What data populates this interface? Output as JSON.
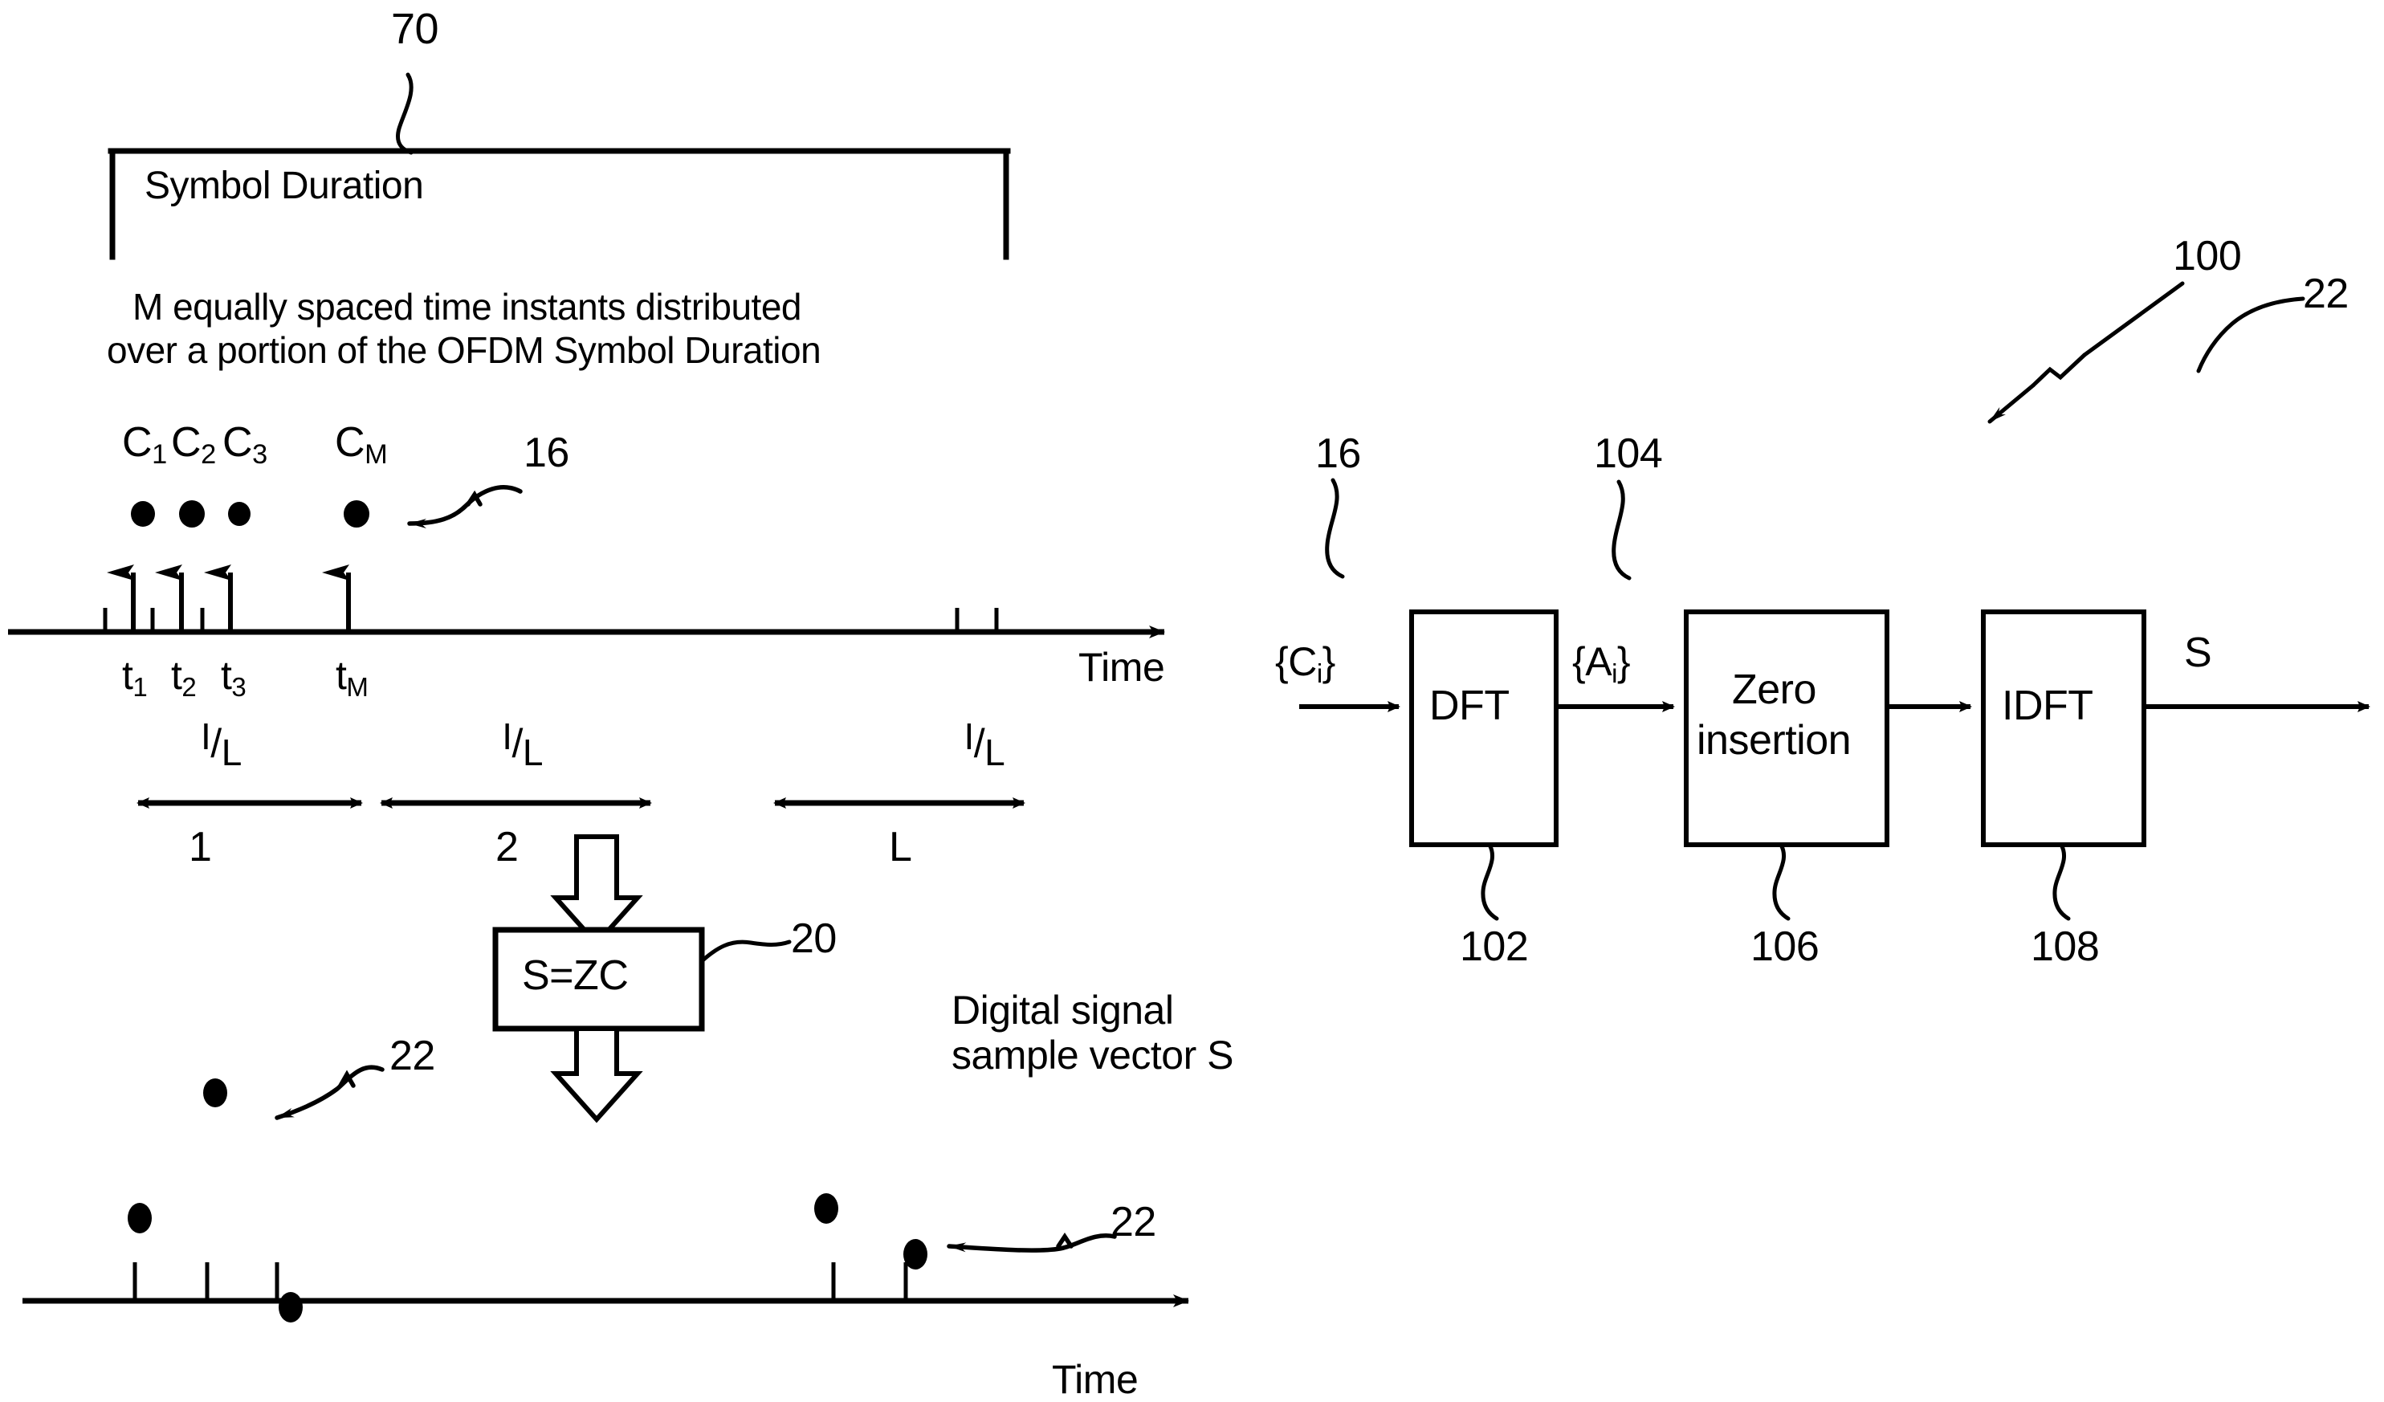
{
  "figure": {
    "title_ref": "70",
    "symbol_duration_label": "Symbol Duration",
    "description_line1": "M equally spaced time instants distributed",
    "description_line2": "over a portion of the OFDM Symbol Duration"
  },
  "coefficients": {
    "c1": "C",
    "c1_sub": "1",
    "c2": "C",
    "c2_sub": "2",
    "c3": "C",
    "c3_sub": "3",
    "cm": "C",
    "cm_sub": "M",
    "ref_16": "16"
  },
  "time_ticks": {
    "t1": "t",
    "t1_sub": "1",
    "t2": "t",
    "t2_sub": "2",
    "t3": "t",
    "t3_sub": "3",
    "tm": "t",
    "tm_sub": "M"
  },
  "axes": {
    "time_label_top": "Time",
    "time_label_bottom": "Time"
  },
  "intervals": {
    "fraction_num": "I",
    "fraction_slash": "/",
    "fraction_den": "L",
    "segment_1": "1",
    "segment_2": "2",
    "segment_L": "L"
  },
  "zc_block": {
    "label": "S=ZC",
    "ref": "20"
  },
  "digital_signal": {
    "caption_line1": "Digital signal",
    "caption_line2": "sample vector S",
    "ref_a": "22",
    "ref_b": "22"
  },
  "block_diagram": {
    "ref_100": "100",
    "input_ref": "16",
    "input_set": "{C",
    "input_set_sub": "i",
    "input_set_close": "}",
    "mid_ref": "104",
    "mid_set": "{A",
    "mid_set_sub": "i",
    "mid_set_close": "}",
    "output_label": "S",
    "output_ref": "22",
    "blocks": [
      {
        "name": "DFT",
        "ref": "102"
      },
      {
        "name": "Zero\ninsertion",
        "ref": "106"
      },
      {
        "name": "IDFT",
        "ref": "108"
      }
    ],
    "block1_label": "DFT",
    "block1_ref": "102",
    "block2_label_line1": "Zero",
    "block2_label_line2": "insertion",
    "block2_ref": "106",
    "block3_label": "IDFT",
    "block3_ref": "108"
  },
  "colors": {
    "ink": "#000000",
    "paper": "#ffffff"
  }
}
